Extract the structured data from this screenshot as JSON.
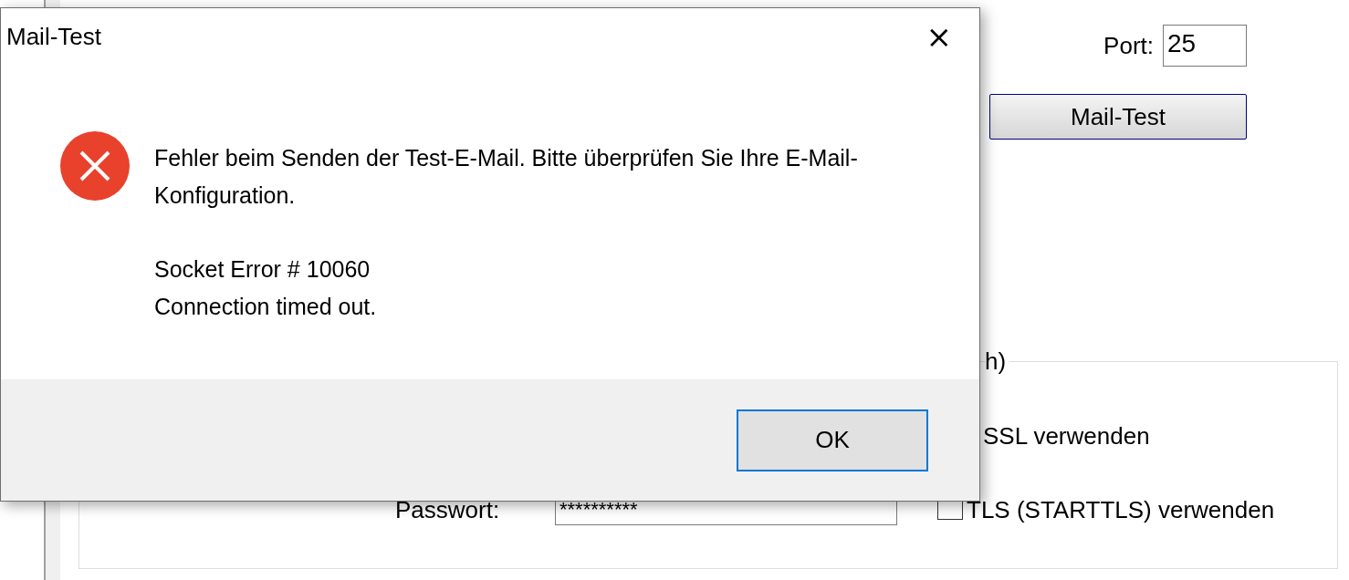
{
  "background_form": {
    "port_label": "Port:",
    "port_value": "25",
    "test_button": "Mail-Test",
    "group_legend": "h)",
    "password_label": "Passwort:",
    "password_value": "**********",
    "options": [
      {
        "label": "SSL verwenden",
        "kind": "text"
      },
      {
        "label": "TLS (STARTTLS) verwenden",
        "kind": "checkbox",
        "checked": false
      }
    ]
  },
  "dialog": {
    "title": "Mail-Test",
    "close": "×",
    "paragraphs": [
      "Fehler beim Senden der Test-E-Mail. Bitte überprüfen Sie Ihre E-Mail-Konfiguration.",
      "Socket Error # 10060\nConnection timed out."
    ],
    "buttons": [
      {
        "label": "OK",
        "selected": true
      }
    ]
  }
}
